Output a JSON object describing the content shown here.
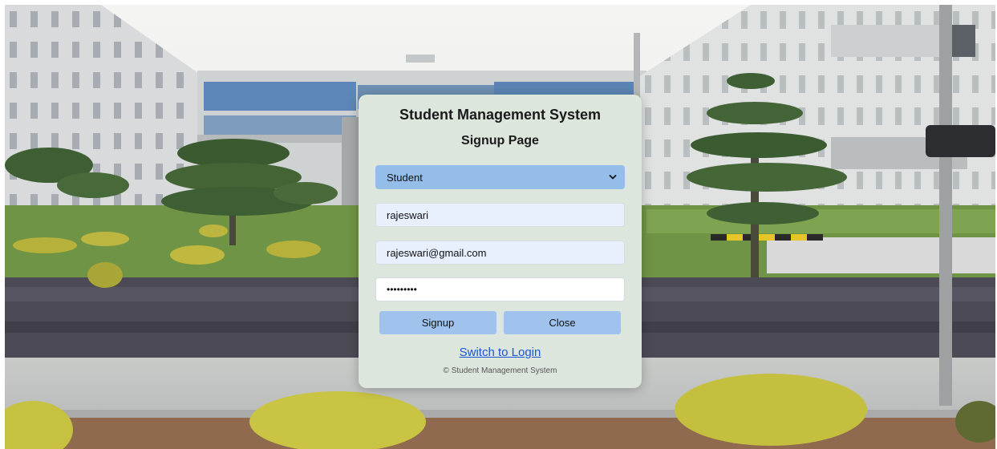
{
  "card": {
    "title": "Student Management System",
    "subtitle": "Signup Page"
  },
  "form": {
    "role": {
      "selected": "Student",
      "icon": "chevron-down-icon"
    },
    "name_value": "rajeswari",
    "email_value": "rajeswari@gmail.com",
    "password_value": "•••••••••"
  },
  "buttons": {
    "signup_label": "Signup",
    "close_label": "Close"
  },
  "links": {
    "switch_label": "Switch to Login"
  },
  "footer": {
    "copyright": "© Student Management System"
  },
  "colors": {
    "card_bg": "#dde6dc",
    "select_bg": "#94bde9",
    "button_bg": "#9fc3ec",
    "link": "#1a55d8"
  }
}
